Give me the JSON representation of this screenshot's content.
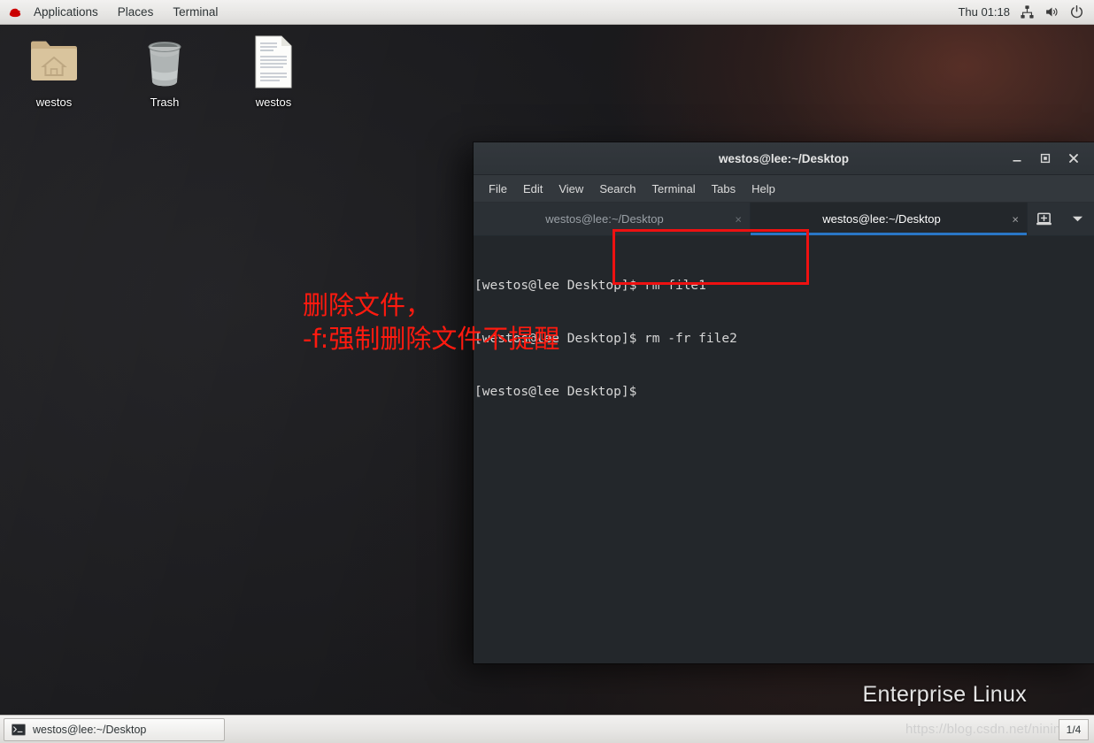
{
  "top_panel": {
    "logo_icon": "redhat-logo-icon",
    "menus": [
      {
        "label": "Applications",
        "name": "panel-menu-applications"
      },
      {
        "label": "Places",
        "name": "panel-menu-places"
      },
      {
        "label": "Terminal",
        "name": "panel-menu-terminal"
      }
    ],
    "clock": "Thu 01:18",
    "tray_icons": [
      "network-icon",
      "volume-icon",
      "power-icon"
    ]
  },
  "desktop": {
    "wallpaper_brand": "Enterprise Linux",
    "icons": [
      {
        "label": "westos",
        "icon": "home-folder-icon",
        "name": "desktop-icon-westos-folder"
      },
      {
        "label": "Trash",
        "icon": "trash-icon",
        "name": "desktop-icon-trash"
      },
      {
        "label": "westos",
        "icon": "text-document-icon",
        "name": "desktop-icon-westos-document"
      }
    ]
  },
  "terminal": {
    "title": "westos@lee:~/Desktop",
    "window_buttons": {
      "minimize": "_",
      "maximize": "▣",
      "close": "✕"
    },
    "menubar": [
      {
        "label": "File",
        "name": "term-menu-file"
      },
      {
        "label": "Edit",
        "name": "term-menu-edit"
      },
      {
        "label": "View",
        "name": "term-menu-view"
      },
      {
        "label": "Search",
        "name": "term-menu-search"
      },
      {
        "label": "Terminal",
        "name": "term-menu-terminal"
      },
      {
        "label": "Tabs",
        "name": "term-menu-tabs"
      },
      {
        "label": "Help",
        "name": "term-menu-help"
      }
    ],
    "tabs": [
      {
        "label": "westos@lee:~/Desktop",
        "active": false,
        "close": "×"
      },
      {
        "label": "westos@lee:~/Desktop",
        "active": true,
        "close": "×"
      }
    ],
    "new_tab_icon": "new-tab-icon",
    "tab_dropdown_icon": "chevron-down-icon",
    "active_tab_accent": "#2a76c6",
    "lines": [
      "[westos@lee Desktop]$ rm file1",
      "[westos@lee Desktop]$ rm -fr file2",
      "[westos@lee Desktop]$"
    ]
  },
  "annotations": {
    "color": "#ff1a0f",
    "note_line1": "删除文件，",
    "note_line2": "-f:强制删除文件不提醒"
  },
  "taskbar": {
    "window_button_label": "westos@lee:~/Desktop",
    "window_button_icon": "terminal-icon",
    "watermark": "https://blog.csdn.net/ninini",
    "workspace_indicator": "1/4"
  }
}
